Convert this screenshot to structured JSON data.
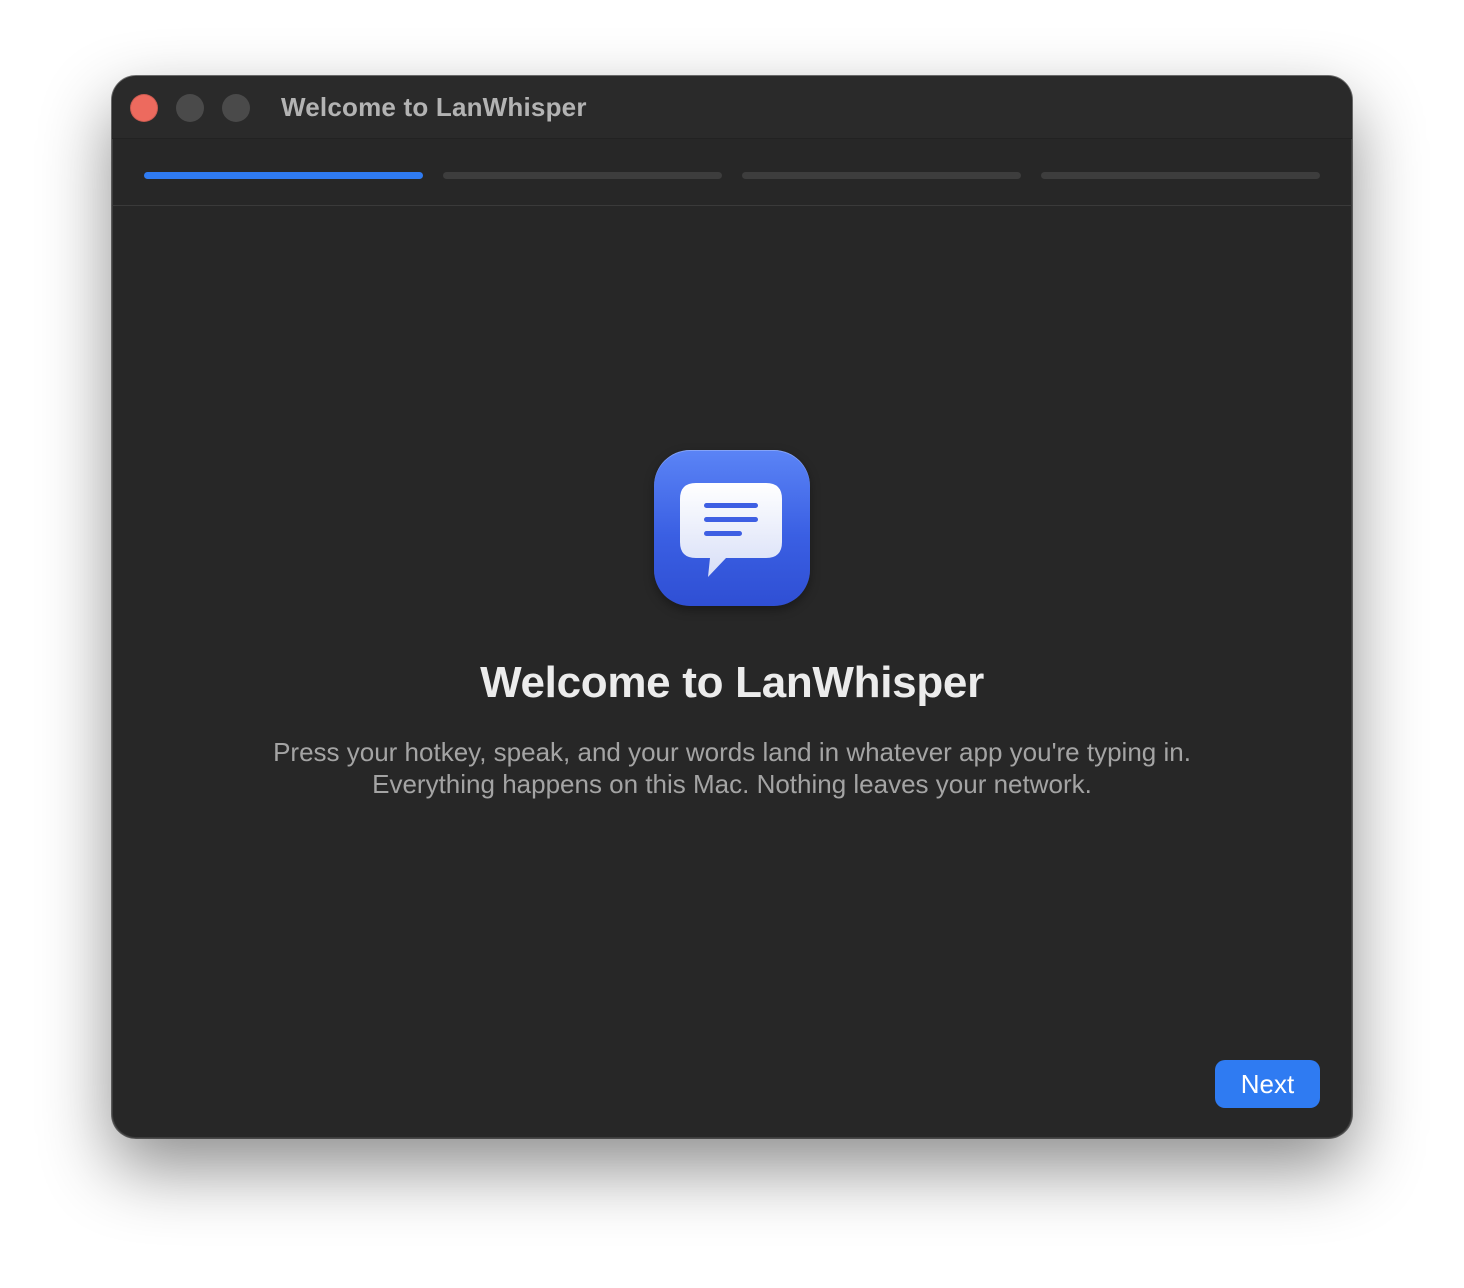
{
  "window": {
    "title": "Welcome to LanWhisper"
  },
  "progress": {
    "total_steps": 4,
    "current_step": 1,
    "active_color": "#2f7bf2",
    "inactive_color": "#3d3d3d"
  },
  "app_icon": {
    "name": "chat-bubble-icon",
    "color": "#3a5fe3"
  },
  "content": {
    "headline": "Welcome to LanWhisper",
    "subtext_line1": "Press your hotkey, speak, and your words land in whatever app you're typing in.",
    "subtext_line2": "Everything happens on this Mac. Nothing leaves your network."
  },
  "footer": {
    "next_label": "Next"
  }
}
